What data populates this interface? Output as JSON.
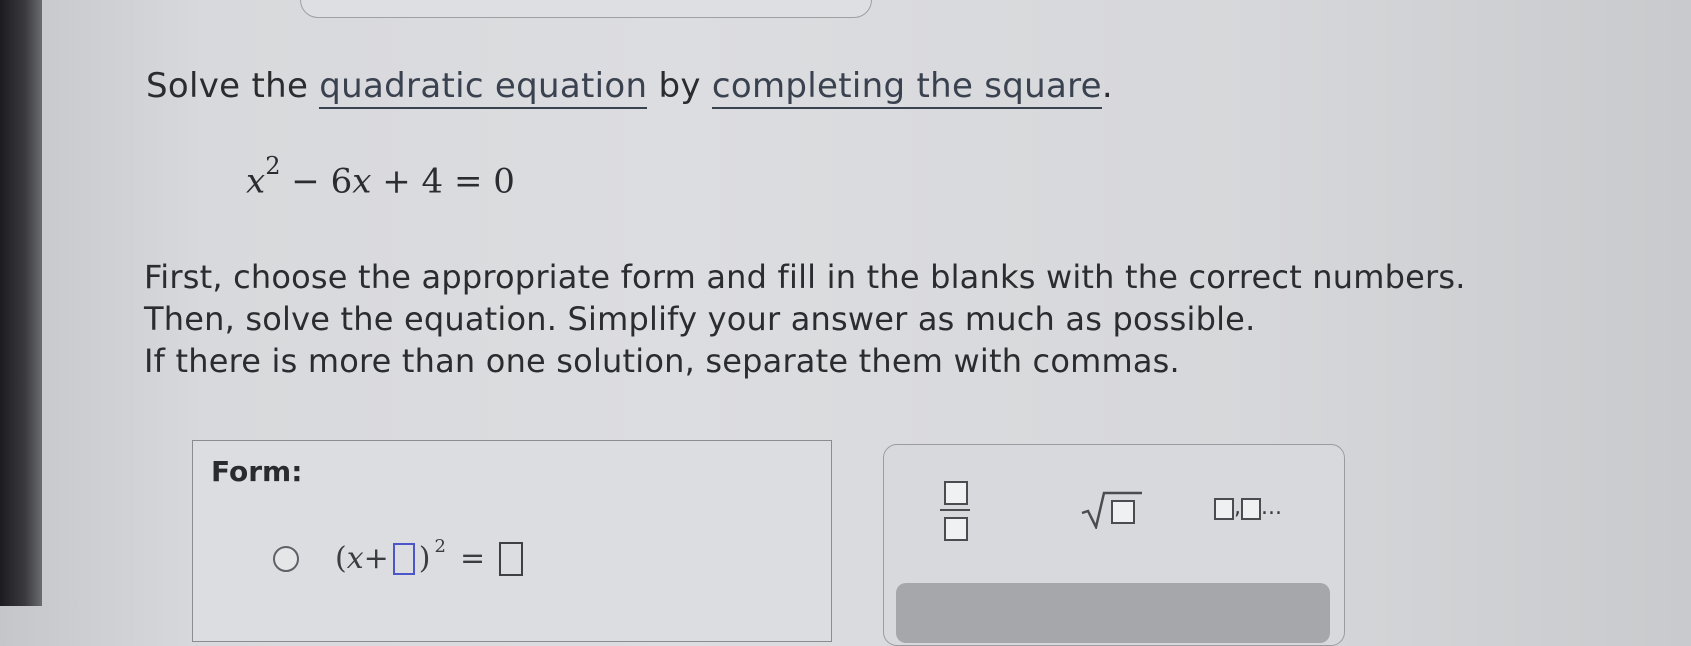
{
  "question": {
    "prefix": "Solve the ",
    "link1": "quadratic equation",
    "middle": " by ",
    "link2": "completing the square",
    "suffix": "."
  },
  "equation": {
    "var1": "x",
    "exp": "2",
    "rest": " − 6",
    "var2": "x",
    "tail": " + 4 = 0"
  },
  "instructions": [
    "First, choose the appropriate form and fill in the blanks with the correct numbers.",
    "Then, solve the equation. Simplify your answer as much as possible.",
    "If there is more than one solution, separate them with commas."
  ],
  "form": {
    "label": "Form:",
    "option1": {
      "open": "(",
      "var": "x",
      "plus": " + ",
      "close": ")",
      "exp": "2",
      "equals": " = "
    }
  },
  "palette": {
    "list_suffix": "...",
    "list_sep": ","
  }
}
